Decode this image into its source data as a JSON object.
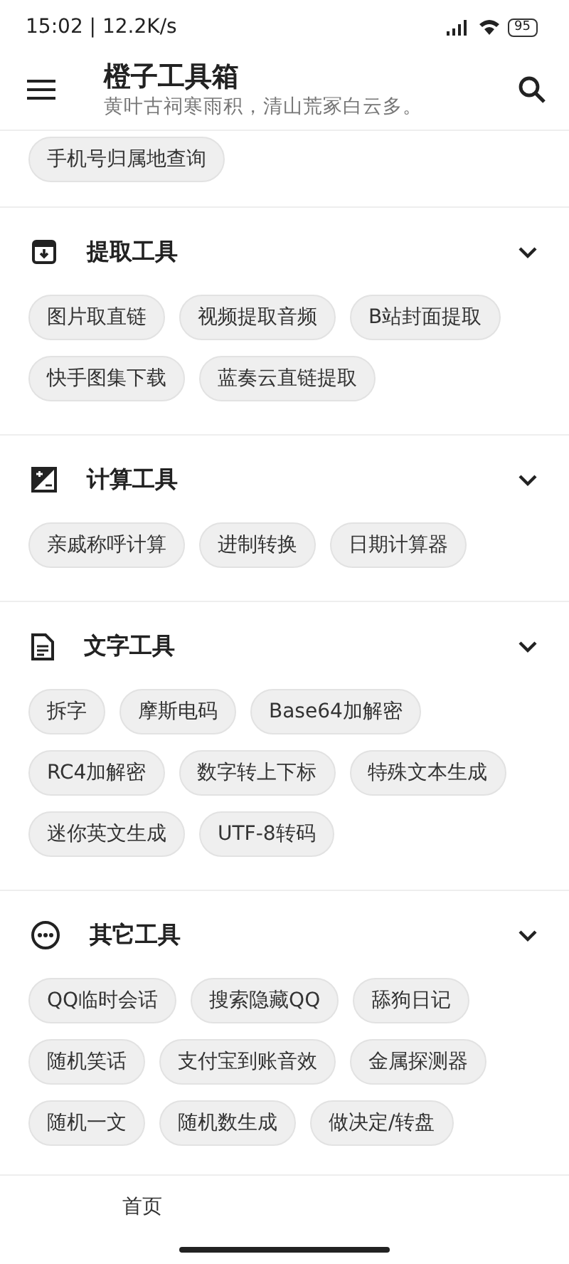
{
  "status_bar": {
    "time": "15:02 | 12.2K/s",
    "battery": "95"
  },
  "app_bar": {
    "title": "橙子工具箱",
    "subtitle": "黄叶古祠寒雨积，清山荒冢白云多。"
  },
  "top_chips": [
    "手机号归属地查询"
  ],
  "sections": [
    {
      "title": "提取工具",
      "expanded": true,
      "tools": [
        "图片取直链",
        "视频提取音频",
        "B站封面提取",
        "快手图集下载",
        "蓝奏云直链提取"
      ]
    },
    {
      "title": "计算工具",
      "expanded": true,
      "tools": [
        "亲戚称呼计算",
        "进制转换",
        "日期计算器"
      ]
    },
    {
      "title": "文字工具",
      "expanded": true,
      "tools": [
        "拆字",
        "摩斯电码",
        "Base64加解密",
        "RC4加解密",
        "数字转上下标",
        "特殊文本生成",
        "迷你英文生成",
        "UTF-8转码"
      ]
    },
    {
      "title": "其它工具",
      "expanded": true,
      "tools": [
        "QQ临时会话",
        "搜索隐藏QQ",
        "舔狗日记",
        "随机笑话",
        "支付宝到账音效",
        "金属探测器",
        "随机一文",
        "随机数生成",
        "做决定/转盘"
      ]
    }
  ],
  "bottom_nav": [
    {
      "label": "首页",
      "selected": true
    }
  ]
}
